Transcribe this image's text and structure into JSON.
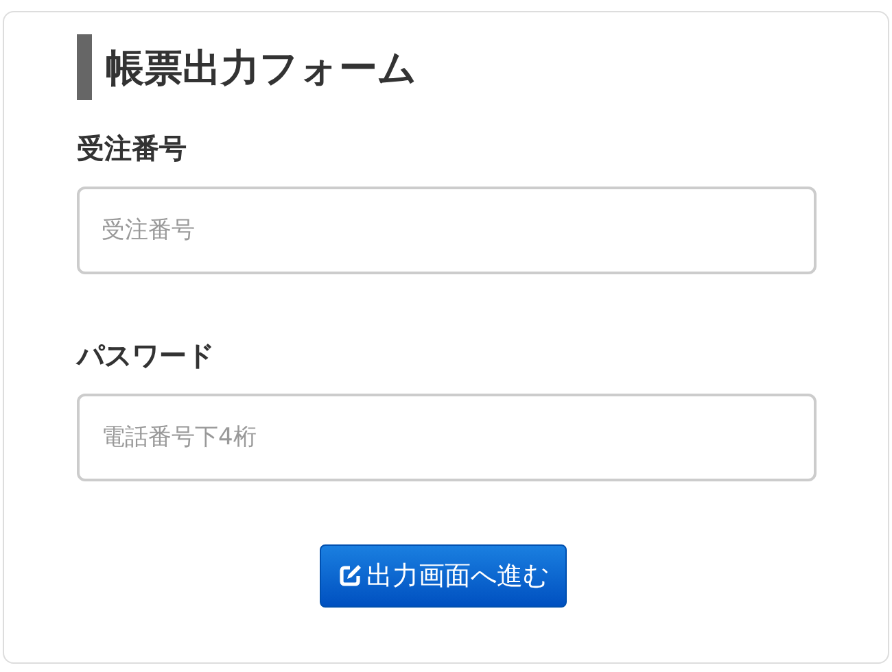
{
  "title": "帳票出力フォーム",
  "fields": [
    {
      "label": "受注番号",
      "placeholder": "受注番号"
    },
    {
      "label": "パスワード",
      "placeholder": "電話番号下4桁"
    }
  ],
  "submit_button": {
    "label": "出力画面へ進む"
  }
}
